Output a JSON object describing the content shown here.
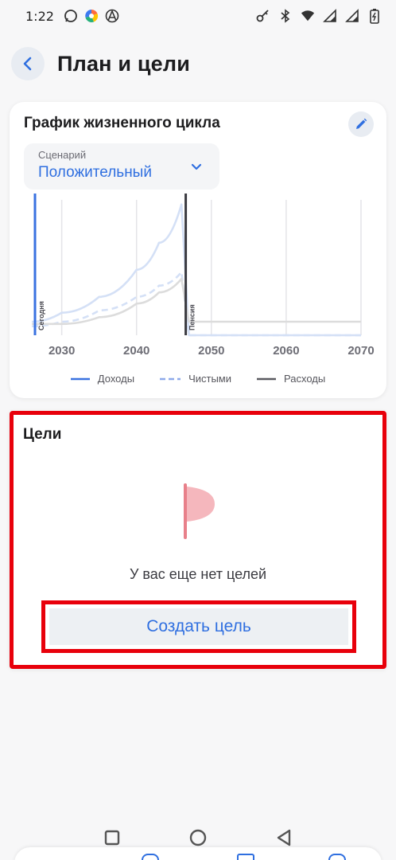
{
  "status_bar": {
    "time": "1:22",
    "left_icons": [
      "whatsapp-icon",
      "colorful-app-icon",
      "anarchy-app-icon"
    ],
    "right_icons": [
      "key-icon",
      "bluetooth-icon",
      "wifi-icon",
      "signal-icon",
      "signal-icon",
      "battery-icon"
    ]
  },
  "header": {
    "title": "План и цели"
  },
  "lifecycle_card": {
    "title": "График жизненного цикла",
    "scenario": {
      "label": "Сценарий",
      "value": "Положительный"
    },
    "today_marker": "Сегодня",
    "pension_marker": "Пенсия",
    "legend": [
      "Доходы",
      "Чистыми",
      "Расходы"
    ]
  },
  "chart_data": {
    "type": "line",
    "x_ticks": [
      2030,
      2040,
      2050,
      2060,
      2070
    ],
    "xlim": [
      2026,
      2070
    ],
    "y_axis_labels": "none",
    "today_year": 2026,
    "pension_year": 2047,
    "series": [
      {
        "name": "Доходы",
        "style": "solid",
        "color": "#d4e0f6",
        "x": [
          2026,
          2030,
          2035,
          2040,
          2043,
          2046,
          2047,
          2070
        ],
        "y": [
          6,
          10,
          17,
          29,
          41,
          58,
          0,
          0
        ]
      },
      {
        "name": "Чистыми",
        "style": "dashed",
        "color": "#d4e0f6",
        "x": [
          2026,
          2030,
          2035,
          2040,
          2043,
          2046,
          2047,
          2070
        ],
        "y": [
          4,
          6,
          11,
          17,
          22,
          28,
          0,
          0
        ]
      },
      {
        "name": "Расходы",
        "style": "solid",
        "color": "#dcdcdc",
        "x": [
          2026,
          2030,
          2035,
          2040,
          2043,
          2046,
          2047,
          2070
        ],
        "y": [
          5,
          5,
          8,
          14,
          19,
          25,
          6,
          6
        ]
      }
    ],
    "legend_placement": "bottom",
    "grid": true
  },
  "goals_card": {
    "title": "Цели",
    "empty_text": "У вас еще нет целей",
    "create_button": "Создать цель"
  },
  "colors": {
    "accent": "#2f6fe0",
    "highlight": "#e8000b",
    "flag": "#e8808a"
  }
}
